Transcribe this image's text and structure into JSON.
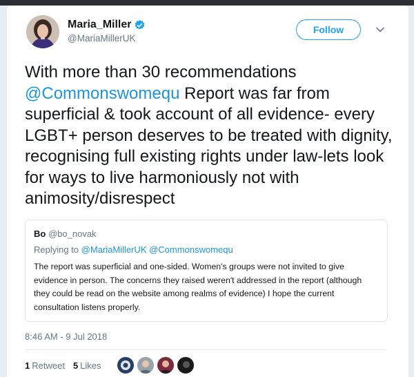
{
  "author": {
    "display_name": "Maria_Miller",
    "handle": "@MariaMillerUK",
    "verified": true,
    "avatar_icon": "profile-photo"
  },
  "follow_label": "Follow",
  "menu_icon": "chevron-down-icon",
  "tweet": {
    "text_before": "With more than 30 recommendations ",
    "mention": "@Commonswomequ",
    "text_after": " Report was far from superficial & took account of all evidence- every LGBT+ person deserves to be treated with dignity, recognising full existing rights under law-lets look for ways to live harmoniously not with animosity/disrespect"
  },
  "quoted": {
    "name": "Bo",
    "handle": "@bo_novak",
    "replying_prefix": "Replying to",
    "replying_mentions": "@MariaMillerUK @Commonswomequ",
    "body": "The report was superficial and one-sided. Women's groups were not invited to give evidence in person. The concerns they raised weren't addressed in the report (although they could be read on the website among realms of evidence)   I hope the current consultation listens properly."
  },
  "timestamp": "8:46 AM - 9 Jul 2018",
  "stats": {
    "retweets_count": "1",
    "retweets_label": "Retweet",
    "likes_count": "5",
    "likes_label": "Likes"
  },
  "colors": {
    "accent": "#1da1f2",
    "link": "#1b95e0",
    "muted": "#657786",
    "text": "#14171a"
  }
}
